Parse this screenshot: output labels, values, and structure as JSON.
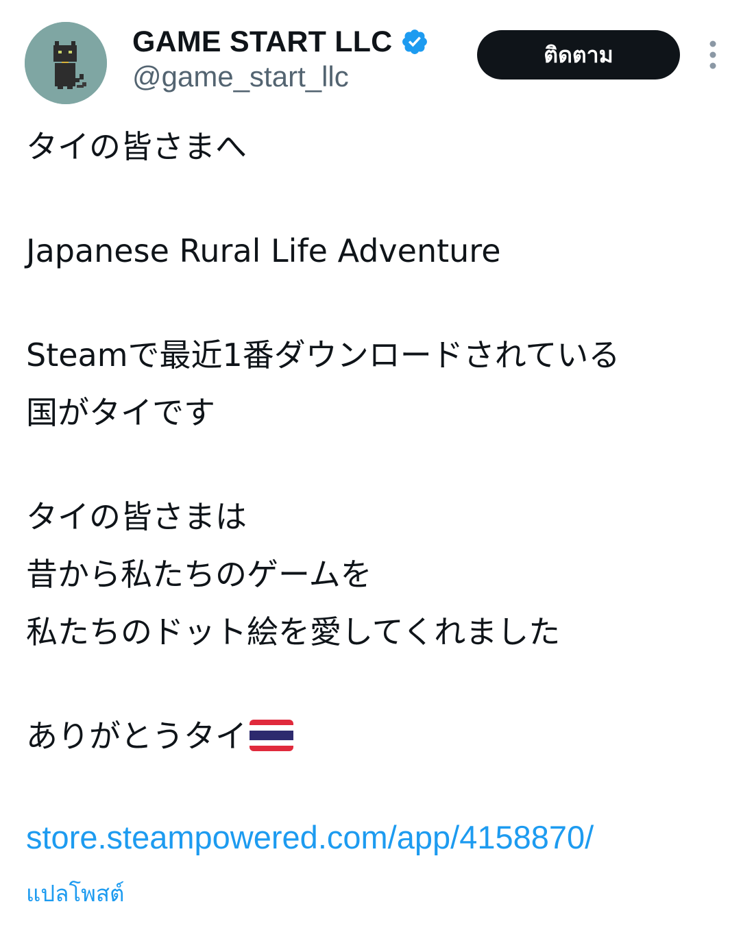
{
  "author": {
    "display_name": "GAME START LLC",
    "handle": "@game_start_llc",
    "verified": true,
    "avatar_icon": "pixel-black-cat-avatar"
  },
  "actions": {
    "follow_label": "ติดตาม",
    "more_icon": "vertical-ellipsis-icon"
  },
  "tweet": {
    "lines": {
      "l1": "タイの皆さまへ",
      "l2": "Japanese Rural Life Adventure",
      "l3": "Steamで最近1番ダウンロードされている",
      "l4": "国がタイです",
      "l5": "タイの皆さまは",
      "l6": "昔から私たちのゲームを",
      "l7": "私たちのドット絵を愛してくれました",
      "l8": "ありがとうタイ"
    },
    "flag_emoji": "thailand-flag",
    "link": "store.steampowered.com/app/4158870/",
    "translate_label": "แปลโพสต์"
  },
  "colors": {
    "accent": "#1d9bf0",
    "text": "#0f1419",
    "secondary": "#536471",
    "follow_bg": "#0f1419"
  }
}
